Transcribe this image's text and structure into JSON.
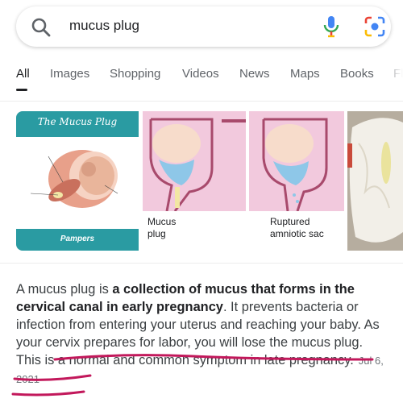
{
  "search": {
    "query": "mucus plug"
  },
  "tabs": [
    {
      "label": "All",
      "active": true
    },
    {
      "label": "Images"
    },
    {
      "label": "Shopping"
    },
    {
      "label": "Videos"
    },
    {
      "label": "News"
    },
    {
      "label": "Maps"
    },
    {
      "label": "Books"
    },
    {
      "label": "Fl"
    }
  ],
  "images": {
    "thumb1": {
      "title": "The Mucus Plug",
      "brand": "Pampers"
    },
    "thumb2": {
      "caption_line1": "Mucus",
      "caption_line2": "plug"
    },
    "thumb3": {
      "caption_line1": "Ruptured",
      "caption_line2": "amniotic sac"
    }
  },
  "snippet": {
    "part1": "A mucus plug is ",
    "bold": "a collection of mucus that forms in the cervical canal in early pregnancy",
    "part2": ". It prevents bacteria or infection from entering your uterus and reaching your baby. As your cervix prepares for labor, you will lose the mucus plug. This is a normal and common symptom in late pregnancy.",
    "date": "Jul 6, 2021"
  },
  "colors": {
    "accent_pink": "#c2185b",
    "google_blue": "#4285f4",
    "pampers_teal": "#2a9ba2",
    "thumb_pink": "#f2c9dd"
  }
}
